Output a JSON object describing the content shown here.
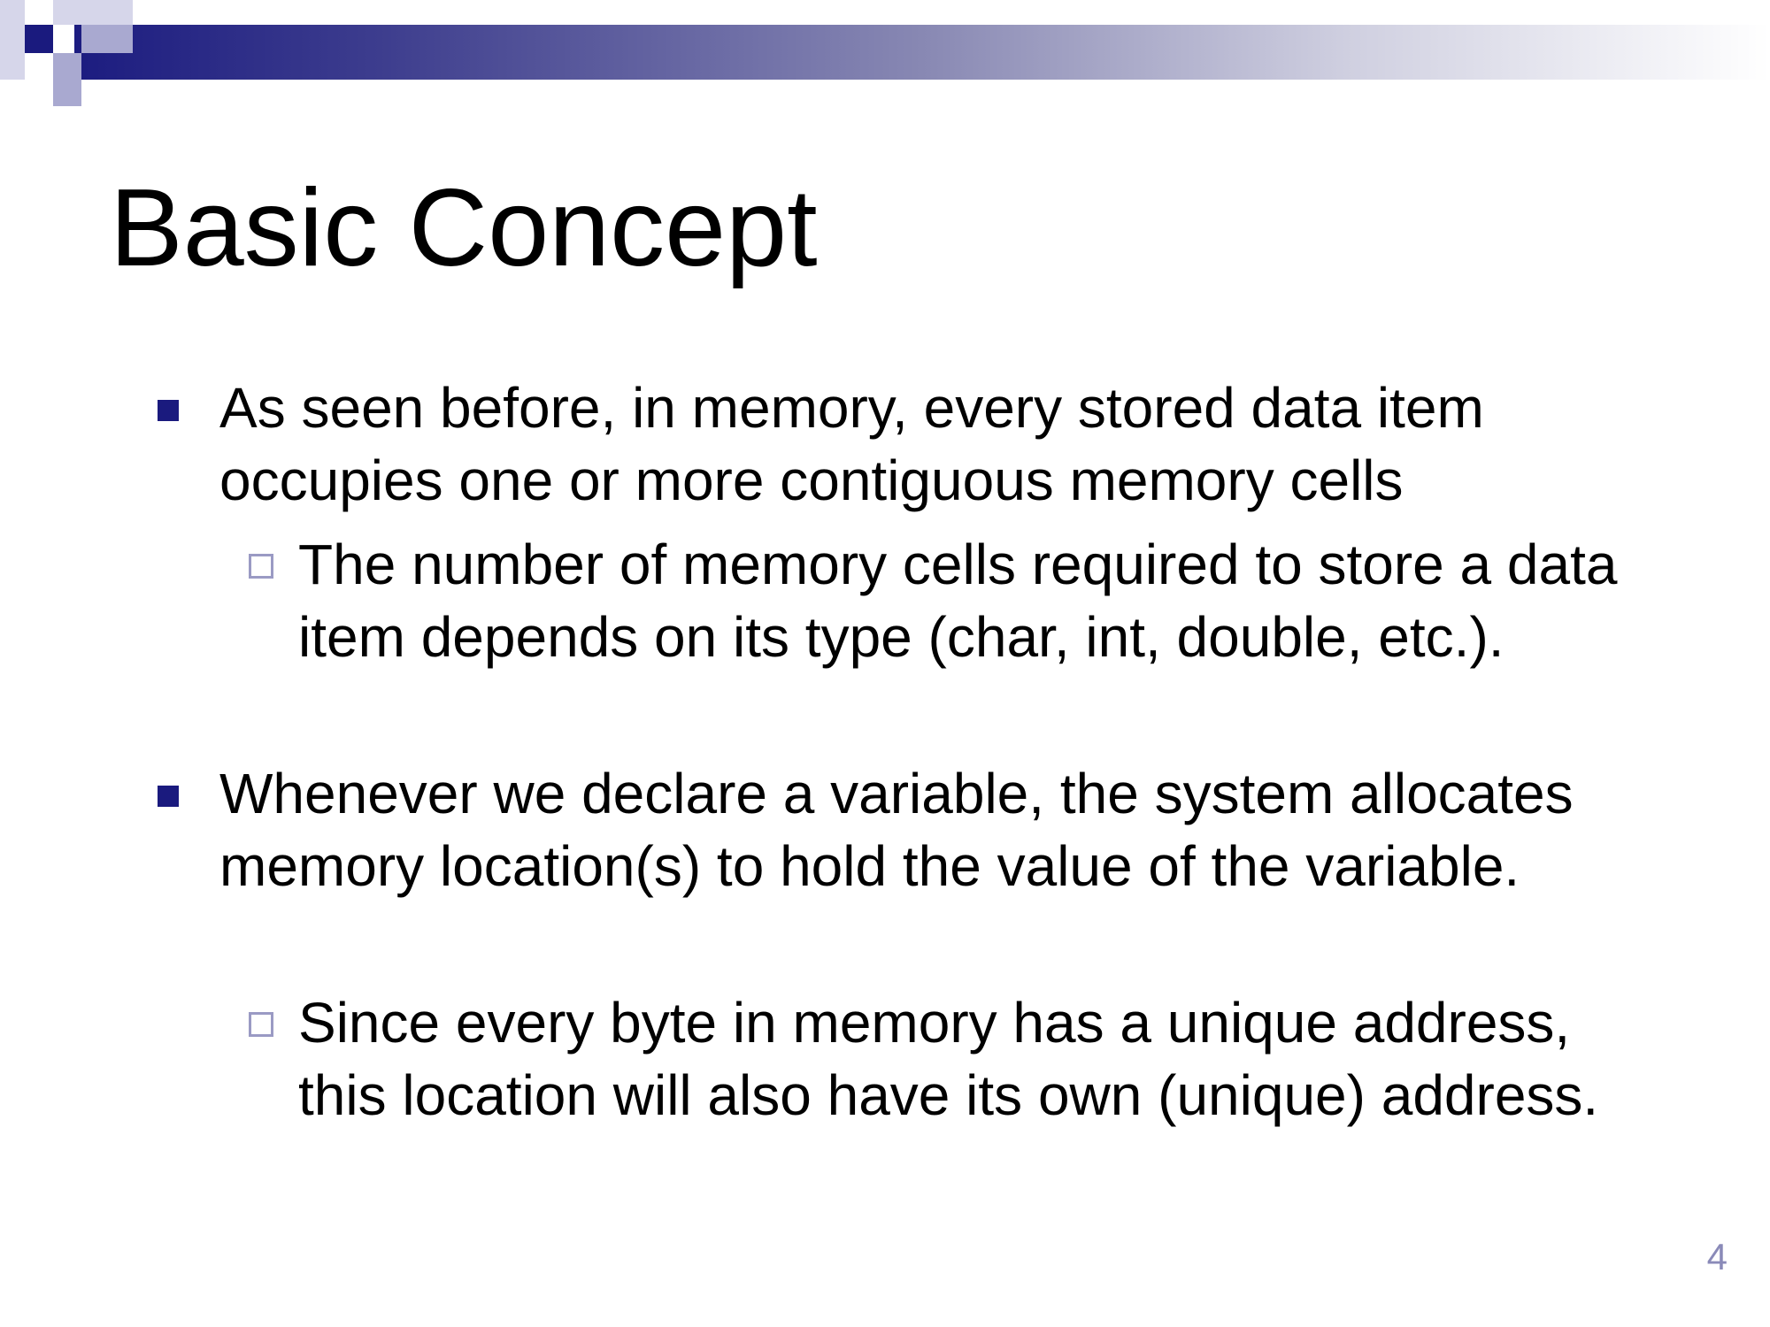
{
  "slide": {
    "title": "Basic Concept",
    "bullets": [
      {
        "text": "As seen before, in memory, every stored data item occupies one or more contiguous memory cells",
        "sub": [
          "The number of memory cells required to store a data item depends on its type (char, int, double, etc.)."
        ]
      },
      {
        "text": "Whenever we declare a variable, the system allocates memory location(s) to hold the value of the variable.",
        "sub": [
          "Since every byte in memory has a unique address, this location will also have its own (unique) address."
        ]
      }
    ],
    "page_number": "4"
  },
  "colors": {
    "accent_dark": "#1a1a7e",
    "accent_light": "#a9a9d0",
    "page_number": "#8a8ab8"
  },
  "icons": {
    "level1_bullet": "filled-square",
    "level2_bullet": "hollow-square"
  }
}
